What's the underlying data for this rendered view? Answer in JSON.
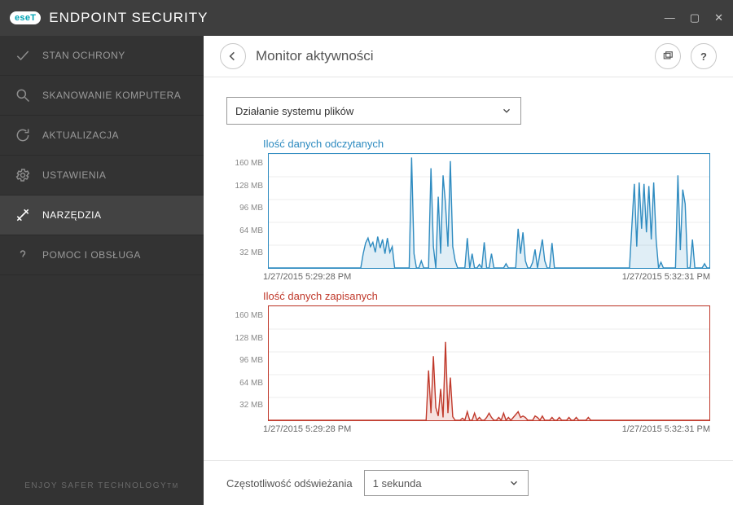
{
  "brand": {
    "logo_text": "eseT",
    "product": "ENDPOINT SECURITY"
  },
  "window_controls": {
    "minimize": "—",
    "maximize": "▢",
    "close": "✕"
  },
  "sidebar": {
    "items": [
      {
        "label": "STAN OCHRONY"
      },
      {
        "label": "SKANOWANIE KOMPUTERA"
      },
      {
        "label": "AKTUALIZACJA"
      },
      {
        "label": "USTAWIENIA"
      },
      {
        "label": "NARZĘDZIA"
      },
      {
        "label": "POMOC I OBSŁUGA"
      }
    ],
    "footer": "ENJOY SAFER TECHNOLOGY",
    "footer_tm": "TM"
  },
  "header": {
    "title": "Monitor aktywności",
    "help_symbol": "?"
  },
  "controls": {
    "activity_selector": "Działanie systemu plików",
    "refresh_label": "Częstotliwość odświeżania",
    "refresh_value": "1 sekunda"
  },
  "y_ticks": [
    "160 MB",
    "128 MB",
    "96 MB",
    "64 MB",
    "32 MB"
  ],
  "time_range": {
    "start": "1/27/2015  5:29:28 PM",
    "end": "1/27/2015  5:32:31 PM"
  },
  "chart_data": [
    {
      "type": "area",
      "title": "Ilość danych odczytanych",
      "ylabel": "MB",
      "ylim": [
        0,
        160
      ],
      "xlim": [
        "1/27/2015 5:29:28 PM",
        "1/27/2015 5:32:31 PM"
      ],
      "x_indices_0_to_182": true,
      "color": "#2e8bc0",
      "values": [
        0,
        0,
        0,
        0,
        0,
        0,
        0,
        0,
        0,
        0,
        0,
        0,
        0,
        0,
        0,
        0,
        0,
        0,
        0,
        0,
        0,
        0,
        0,
        0,
        0,
        0,
        0,
        0,
        0,
        0,
        0,
        0,
        0,
        0,
        0,
        0,
        0,
        0,
        0,
        20,
        35,
        42,
        30,
        36,
        22,
        44,
        28,
        40,
        20,
        42,
        22,
        30,
        0,
        0,
        0,
        0,
        0,
        0,
        0,
        155,
        20,
        0,
        0,
        10,
        0,
        0,
        0,
        140,
        30,
        0,
        100,
        20,
        130,
        90,
        30,
        150,
        30,
        10,
        0,
        0,
        0,
        0,
        42,
        0,
        20,
        0,
        0,
        5,
        0,
        36,
        0,
        0,
        20,
        0,
        0,
        0,
        0,
        0,
        6,
        0,
        0,
        0,
        0,
        55,
        20,
        50,
        10,
        0,
        0,
        8,
        26,
        0,
        20,
        40,
        10,
        0,
        0,
        35,
        0,
        0,
        0,
        0,
        0,
        0,
        0,
        0,
        0,
        0,
        0,
        0,
        0,
        0,
        0,
        0,
        0,
        0,
        0,
        0,
        0,
        0,
        0,
        0,
        0,
        0,
        0,
        0,
        0,
        0,
        0,
        0,
        60,
        118,
        30,
        120,
        55,
        118,
        50,
        115,
        40,
        120,
        40,
        0,
        8,
        0,
        0,
        0,
        0,
        0,
        0,
        130,
        25,
        110,
        90,
        0,
        0,
        40,
        0,
        0,
        0,
        0,
        6,
        0,
        0
      ]
    },
    {
      "type": "area",
      "title": "Ilość danych zapisanych",
      "ylabel": "MB",
      "ylim": [
        0,
        160
      ],
      "xlim": [
        "1/27/2015 5:29:28 PM",
        "1/27/2015 5:32:31 PM"
      ],
      "x_indices_0_to_182": true,
      "color": "#c0392b",
      "values": [
        0,
        0,
        0,
        0,
        0,
        0,
        0,
        0,
        0,
        0,
        0,
        0,
        0,
        0,
        0,
        0,
        0,
        0,
        0,
        0,
        0,
        0,
        0,
        0,
        0,
        0,
        0,
        0,
        0,
        0,
        0,
        0,
        0,
        0,
        0,
        0,
        0,
        0,
        0,
        0,
        0,
        0,
        0,
        0,
        0,
        0,
        0,
        0,
        0,
        0,
        0,
        0,
        0,
        0,
        0,
        0,
        0,
        0,
        0,
        0,
        0,
        0,
        0,
        0,
        0,
        0,
        70,
        10,
        90,
        18,
        6,
        44,
        4,
        110,
        10,
        60,
        5,
        0,
        0,
        0,
        3,
        0,
        12,
        0,
        0,
        10,
        0,
        4,
        0,
        0,
        4,
        10,
        4,
        0,
        0,
        4,
        0,
        10,
        0,
        4,
        0,
        4,
        8,
        12,
        4,
        6,
        4,
        0,
        0,
        0,
        6,
        4,
        0,
        6,
        0,
        0,
        0,
        4,
        0,
        0,
        4,
        0,
        0,
        0,
        4,
        0,
        0,
        4,
        0,
        0,
        0,
        0,
        4,
        0,
        0,
        0,
        0,
        0,
        0,
        0,
        0,
        0,
        0,
        0,
        0,
        0,
        0,
        0,
        0,
        0,
        0,
        0,
        0,
        0,
        0,
        0,
        0,
        0,
        0,
        0,
        0,
        0,
        0,
        0,
        0,
        0,
        0,
        0,
        0,
        0,
        0,
        0,
        0,
        0,
        0,
        0,
        0,
        0,
        0,
        0,
        0,
        0,
        0
      ]
    }
  ]
}
